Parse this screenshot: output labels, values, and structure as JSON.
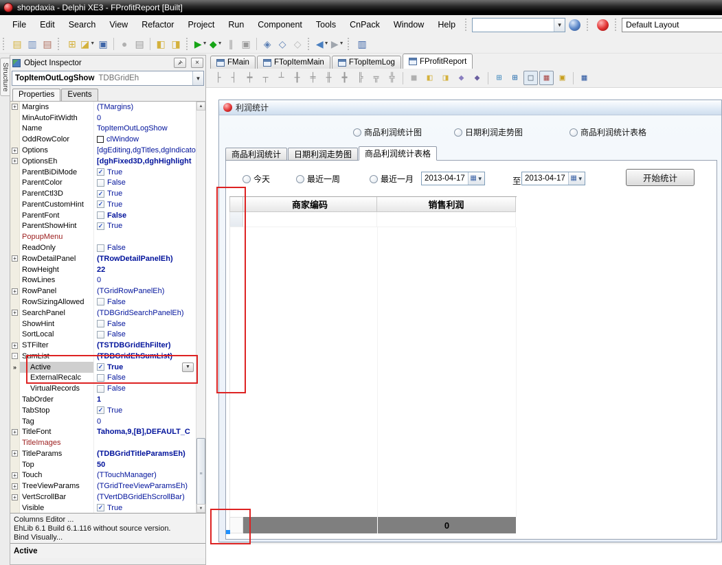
{
  "window": {
    "title": "shopdaxia - Delphi XE3 - FProfitReport [Built]",
    "app_icon": "delphi-red-sphere"
  },
  "menu": {
    "items": [
      "File",
      "Edit",
      "Search",
      "View",
      "Refactor",
      "Project",
      "Run",
      "Component",
      "Tools",
      "CnPack",
      "Window",
      "Help"
    ],
    "search_value": "",
    "layout_combo_value": "Default Layout"
  },
  "toolbar": {
    "groups": [
      {
        "sep": "grip",
        "icons": [
          {
            "n": "new-items-icon",
            "g": "▤",
            "c": "#d4b13c"
          },
          {
            "n": "copy-pages-icon",
            "g": "▥",
            "c": "#6f8fc0"
          },
          {
            "n": "remove-file-icon",
            "g": "▤",
            "c": "#b0705f"
          }
        ]
      },
      {
        "sep": "grip",
        "icons": [
          {
            "n": "new-unit-icon",
            "g": "⊞",
            "c": "#d4b13c"
          },
          {
            "n": "open-file-icon",
            "g": "◪",
            "c": "#d4b13c",
            "dd": true
          },
          {
            "n": "save-icon",
            "g": "▣",
            "c": "#3f66a8"
          }
        ]
      },
      {
        "sep": "line",
        "icons": [
          {
            "n": "save-as-icon",
            "g": "●",
            "c": "#b0b0b0"
          },
          {
            "n": "close-file-icon",
            "g": "▤",
            "c": "#9a9a9a"
          }
        ]
      },
      {
        "sep": "line",
        "icons": [
          {
            "n": "open-project-icon",
            "g": "◧",
            "c": "#d4b13c"
          },
          {
            "n": "add-to-project-icon",
            "g": "◨",
            "c": "#d4b13c"
          }
        ]
      },
      {
        "sep": "grip",
        "icons": [
          {
            "n": "run-icon",
            "g": "▶",
            "c": "#17a517",
            "dd": true
          },
          {
            "n": "run-without-debugging-icon",
            "g": "◆",
            "c": "#17a517",
            "dd": true
          },
          {
            "n": "pause-icon",
            "g": "∥",
            "c": "#9a9a9a"
          },
          {
            "n": "program-reset-icon",
            "g": "▣",
            "c": "#9a9a9a"
          }
        ]
      },
      {
        "sep": "line",
        "icons": [
          {
            "n": "step-over-icon",
            "g": "◈",
            "c": "#5b7fb4"
          },
          {
            "n": "trace-into-icon",
            "g": "◇",
            "c": "#5b7fb4"
          },
          {
            "n": "run-to-cursor-icon",
            "g": "◇",
            "c": "#b8b8b8"
          }
        ]
      },
      {
        "sep": "grip",
        "icons": [
          {
            "n": "navigate-back-icon",
            "g": "◀",
            "c": "#4a7fc0",
            "dd": true
          },
          {
            "n": "navigate-forward-icon",
            "g": "▶",
            "c": "#a0a6ae",
            "dd": true
          }
        ]
      },
      {
        "sep": "grip",
        "icons": [
          {
            "n": "help-book-icon",
            "g": "▥",
            "c": "#3f66a8"
          }
        ]
      }
    ]
  },
  "structure_panel": {
    "label": "Structure"
  },
  "object_inspector": {
    "title": "Object Inspector",
    "object_name": "TopItemOutLogShow",
    "object_type": "TDBGridEh",
    "tabs": [
      "Properties",
      "Events"
    ],
    "active_tab": "Properties",
    "properties": [
      {
        "expand": "+",
        "name": "Margins",
        "value": "(TMargins)"
      },
      {
        "name": "MinAutoFitWidth",
        "value": "0"
      },
      {
        "name": "Name",
        "value": "TopItemOutLogShow"
      },
      {
        "name": "OddRowColor",
        "value": "clWindow",
        "swatch": true
      },
      {
        "expand": "+",
        "name": "Options",
        "value": "[dgEditing,dgTitles,dgIndicato"
      },
      {
        "expand": "+",
        "name": "OptionsEh",
        "value": "[dghFixed3D,dghHighlight",
        "bold": true
      },
      {
        "name": "ParentBiDiMode",
        "value": "True",
        "check": true
      },
      {
        "name": "ParentColor",
        "value": "False",
        "check": false
      },
      {
        "name": "ParentCtl3D",
        "value": "True",
        "check": true
      },
      {
        "name": "ParentCustomHint",
        "value": "True",
        "check": true
      },
      {
        "name": "ParentFont",
        "value": "False",
        "check": false,
        "bold": true
      },
      {
        "name": "ParentShowHint",
        "value": "True",
        "check": true
      },
      {
        "name": "PopupMenu",
        "value": "",
        "red": true
      },
      {
        "name": "ReadOnly",
        "value": "False",
        "check": false
      },
      {
        "expand": "+",
        "name": "RowDetailPanel",
        "value": "(TRowDetailPanelEh)",
        "bold": true
      },
      {
        "name": "RowHeight",
        "value": "22",
        "bold": true
      },
      {
        "name": "RowLines",
        "value": "0"
      },
      {
        "expand": "+",
        "name": "RowPanel",
        "value": "(TGridRowPanelEh)"
      },
      {
        "name": "RowSizingAllowed",
        "value": "False",
        "check": false
      },
      {
        "expand": "+",
        "name": "SearchPanel",
        "value": "(TDBGridSearchPanelEh)"
      },
      {
        "name": "ShowHint",
        "value": "False",
        "check": false
      },
      {
        "name": "SortLocal",
        "value": "False",
        "check": false
      },
      {
        "expand": "+",
        "name": "STFilter",
        "value": "(TSTDBGridEhFilter)",
        "bold": true
      },
      {
        "expand": "-",
        "name": "SumList",
        "value": "(TDBGridEhSumList)",
        "bold": true
      },
      {
        "name": "Active",
        "value": "True",
        "check": true,
        "bold": true,
        "child": true,
        "selected": true,
        "dropdown": true
      },
      {
        "name": "ExternalRecalc",
        "value": "False",
        "check": false,
        "child": true
      },
      {
        "name": "VirtualRecords",
        "value": "False",
        "check": false,
        "child": true
      },
      {
        "name": "TabOrder",
        "value": "1",
        "bold": true
      },
      {
        "name": "TabStop",
        "value": "True",
        "check": true
      },
      {
        "name": "Tag",
        "value": "0"
      },
      {
        "expand": "+",
        "name": "TitleFont",
        "value": "Tahoma,9,[B],DEFAULT_C",
        "bold": true
      },
      {
        "name": "TitleImages",
        "value": "",
        "red": true
      },
      {
        "expand": "+",
        "name": "TitleParams",
        "value": "(TDBGridTitleParamsEh)",
        "bold": true
      },
      {
        "name": "Top",
        "value": "50",
        "bold": true
      },
      {
        "expand": "+",
        "name": "Touch",
        "value": "(TTouchManager)"
      },
      {
        "expand": "+",
        "name": "TreeViewParams",
        "value": "(TGridTreeViewParamsEh)"
      },
      {
        "expand": "+",
        "name": "VertScrollBar",
        "value": "(TVertDBGridEhScrollBar)"
      },
      {
        "name": "Visible",
        "value": "True",
        "check": true
      }
    ],
    "links": [
      "Columns Editor ...",
      "EhLib 6.1 Build 6.1.116 without source version.",
      "Bind Visually..."
    ],
    "status": "Active"
  },
  "designer": {
    "tabs": [
      {
        "label": "FMain",
        "active": false
      },
      {
        "label": "FTopItemMain",
        "active": false
      },
      {
        "label": "FTopItemLog",
        "active": false
      },
      {
        "label": "FProfitReport",
        "active": true
      }
    ],
    "align_icons": [
      {
        "n": "align-left-edges-icon",
        "g": "├",
        "c": "#9a9a9a"
      },
      {
        "n": "align-right-edges-icon",
        "g": "┤",
        "c": "#9a9a9a"
      },
      {
        "n": "align-horizontal-centers-icon",
        "g": "┿",
        "c": "#9a9a9a"
      },
      {
        "n": "align-top-edges-icon",
        "g": "┬",
        "c": "#9a9a9a"
      },
      {
        "n": "align-bottom-edges-icon",
        "g": "┴",
        "c": "#9a9a9a"
      },
      {
        "n": "align-vertical-centers-icon",
        "g": "╂",
        "c": "#9a9a9a"
      },
      {
        "n": "space-equally-horizontal-icon",
        "g": "╪",
        "c": "#9a9a9a"
      },
      {
        "n": "space-equally-vertical-icon",
        "g": "╫",
        "c": "#9a9a9a"
      },
      {
        "n": "center-in-window-icon",
        "g": "╋",
        "c": "#9a9a9a"
      },
      {
        "n": "make-same-width-icon",
        "g": "╠",
        "c": "#9a9a9a"
      },
      {
        "n": "make-same-height-icon",
        "g": "╦",
        "c": "#9a9a9a"
      },
      {
        "n": "make-same-size-icon",
        "g": "╬",
        "c": "#9a9a9a"
      },
      {
        "n": "selection-box-icon",
        "g": "■",
        "c": "#b0b0b0",
        "sep_before": true
      },
      {
        "n": "bring-to-front-icon",
        "g": "◧",
        "c": "#d4b13c"
      },
      {
        "n": "send-to-back-icon",
        "g": "◨",
        "c": "#d4b13c"
      },
      {
        "n": "bring-forward-icon",
        "g": "◆",
        "c": "#8a7fc0"
      },
      {
        "n": "send-backward-icon",
        "g": "◆",
        "c": "#6a5fa0"
      },
      {
        "n": "align-to-grid-icon",
        "g": "⊞",
        "c": "#4a8fc0",
        "sep_before": true
      },
      {
        "n": "size-to-grid-icon",
        "g": "⊞",
        "c": "#2a6faf"
      },
      {
        "n": "snap-to-grid-icon",
        "g": "□",
        "c": "#5a6a7a",
        "pressed": true
      },
      {
        "n": "show-grid-icon",
        "g": "▦",
        "c": "#b05a5a",
        "pressed": true
      },
      {
        "n": "lock-controls-icon",
        "g": "▣",
        "c": "#c8a020"
      },
      {
        "n": "view-as-table-icon",
        "g": "▦",
        "c": "#3f66a8",
        "sep_before": true
      }
    ]
  },
  "form": {
    "title": "利润统计",
    "title_icon": "red-sphere",
    "radio_options": [
      "商品利润统计图",
      "日期利润走势图",
      "商品利润统计表格"
    ],
    "page_tabs": [
      {
        "label": "商品利润统计",
        "active": false
      },
      {
        "label": "日期利润走势图",
        "active": false
      },
      {
        "label": "商品利润统计表格",
        "active": true
      }
    ],
    "filters": {
      "radios": [
        "今天",
        "最近一周",
        "最近一月"
      ],
      "date_from": "2013-04-17",
      "to_label": "至",
      "date_to": "2013-04-17",
      "start_button": "开始统计"
    },
    "grid": {
      "columns": [
        "商家编码",
        "销售利润"
      ],
      "footer_values": [
        "",
        "0"
      ]
    }
  },
  "annotations": {
    "color": "#dd2222",
    "count": 3
  },
  "colors": {
    "titlebar": "#0a0a0a",
    "chrome": "#f0f0f0",
    "value_navy": "#00129b",
    "prop_red": "#9b1c1c",
    "footer_gray": "#7f7f7f",
    "annotation_red": "#dd2222",
    "selection_handle_blue": "#1e90ff"
  }
}
